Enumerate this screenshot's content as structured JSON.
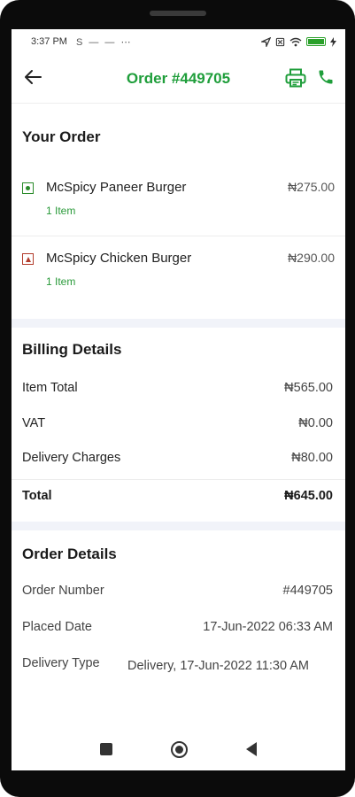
{
  "status_bar": {
    "time": "3:37 PM",
    "indicators": "S — — ⋯",
    "right_icons": [
      "location-icon",
      "no-sim-icon",
      "wifi-icon",
      "battery-icon",
      "charging-icon"
    ]
  },
  "header": {
    "title": "Order #449705",
    "back_icon": "back-arrow-icon",
    "actions": [
      "printer-icon",
      "phone-icon"
    ],
    "accent_color": "#1f9e3b"
  },
  "your_order": {
    "title": "Your Order",
    "items": [
      {
        "name": "McSpicy Paneer Burger",
        "price": "₦275.00",
        "qty": "1 Item",
        "type": "veg"
      },
      {
        "name": "McSpicy Chicken Burger",
        "price": "₦290.00",
        "qty": "1 Item",
        "type": "non-veg"
      }
    ]
  },
  "billing": {
    "title": "Billing Details",
    "rows": [
      {
        "label": "Item Total",
        "value": "₦565.00"
      },
      {
        "label": "VAT",
        "value": "₦0.00"
      },
      {
        "label": "Delivery Charges",
        "value": "₦80.00"
      }
    ],
    "total": {
      "label": "Total",
      "value": "₦645.00"
    }
  },
  "order_details": {
    "title": "Order Details",
    "rows": [
      {
        "label": "Order Number",
        "value": "#449705"
      },
      {
        "label": "Placed Date",
        "value": "17-Jun-2022 06:33 AM"
      },
      {
        "label": "Delivery Type",
        "value": "Delivery, 17-Jun-2022 11:30 AM"
      }
    ]
  },
  "nav": [
    "recent-apps-icon",
    "home-icon",
    "back-icon"
  ]
}
